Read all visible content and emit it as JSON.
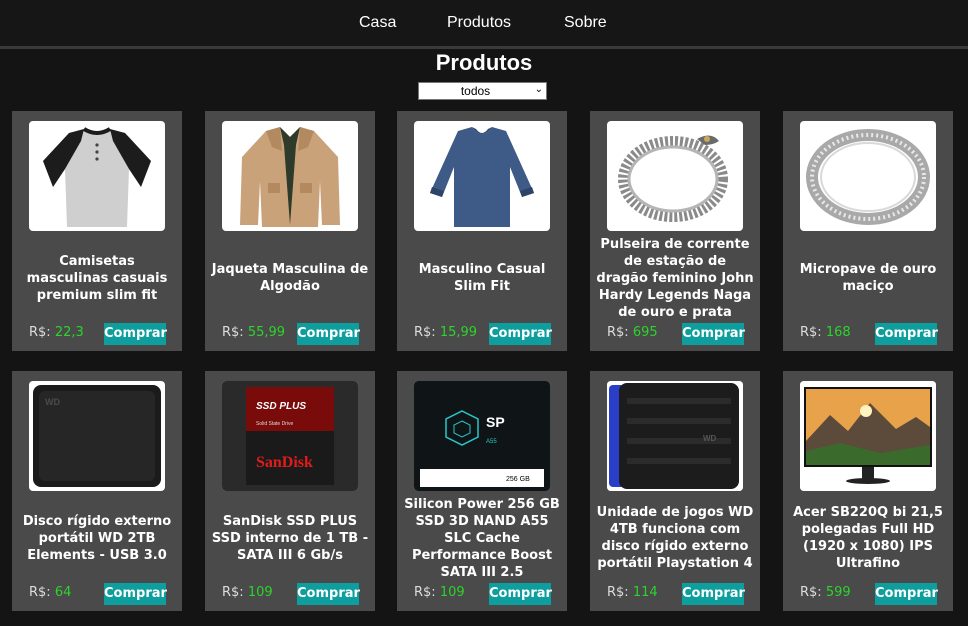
{
  "nav": {
    "home": "Casa",
    "products": "Produtos",
    "about": "Sobre"
  },
  "page_title": "Produtos",
  "filter": {
    "selected": "todos"
  },
  "currency": "R$:",
  "buy_label": "Comprar",
  "products": [
    {
      "name": "Camisetas masculinas casuais premium slim fit",
      "price": "22,3",
      "image": "raglan-shirt"
    },
    {
      "name": "Jaqueta Masculina de Algodão",
      "price": "55,99",
      "image": "cotton-jacket"
    },
    {
      "name": "Masculino Casual Slim Fit",
      "price": "15,99",
      "image": "slim-shirt"
    },
    {
      "name": "Pulseira de corrente de estação de dragão feminino John Hardy Legends Naga de ouro e prata",
      "price": "695",
      "image": "dragon-bracelet"
    },
    {
      "name": "Micropave de ouro maciço",
      "price": "168",
      "image": "silver-ring"
    },
    {
      "name": "Disco rígido externo portátil WD 2TB Elements - USB 3.0",
      "price": "64",
      "image": "wd-drive"
    },
    {
      "name": "SanDisk SSD PLUS SSD interno de 1 TB - SATA III 6 Gb/s",
      "price": "109",
      "image": "sandisk-ssd"
    },
    {
      "name": "Silicon Power 256 GB SSD 3D NAND A55 SLC Cache Performance Boost SATA III 2.5",
      "price": "109",
      "image": "sp-ssd"
    },
    {
      "name": "Unidade de jogos WD 4TB funciona com disco rígido externo portátil Playstation 4",
      "price": "114",
      "image": "wd-gaming-drive"
    },
    {
      "name": "Acer SB220Q bi 21,5 polegadas Full HD (1920 x 1080) IPS Ultrafino",
      "price": "599",
      "image": "acer-monitor"
    }
  ],
  "image_text": {
    "sandisk_line1": "SSD PLUS",
    "sandisk_line2": "Solid State Drive",
    "sandisk_brand": "SanDisk",
    "sp_logo": "SP",
    "sp_model": "A55",
    "sp_capacity": "256 GB",
    "wd_logo": "WD"
  }
}
